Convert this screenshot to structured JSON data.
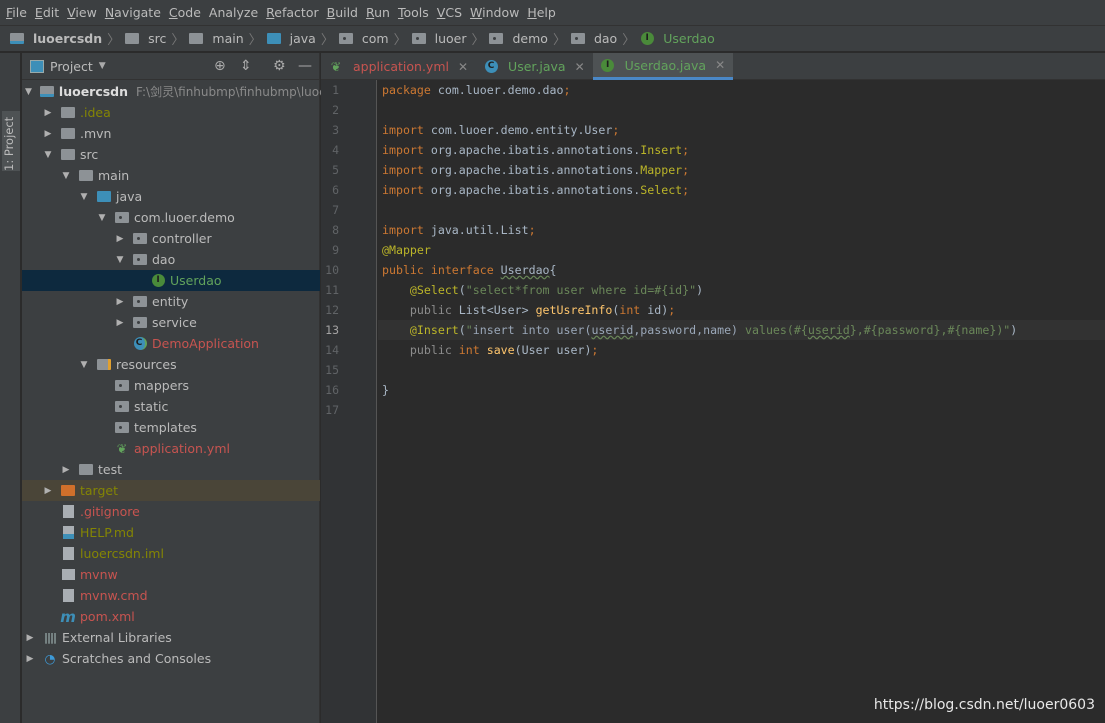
{
  "menu": [
    {
      "u": "F",
      "rest": "ile"
    },
    {
      "u": "E",
      "rest": "dit"
    },
    {
      "u": "V",
      "rest": "iew"
    },
    {
      "u": "N",
      "rest": "avigate"
    },
    {
      "u": "C",
      "rest": "ode"
    },
    {
      "u": "",
      "rest": "Analyze"
    },
    {
      "u": "R",
      "rest": "efactor"
    },
    {
      "u": "B",
      "rest": "uild"
    },
    {
      "u": "R",
      "rest": "un"
    },
    {
      "u": "T",
      "rest": "ools"
    },
    {
      "u": "V",
      "rest": "CS"
    },
    {
      "u": "W",
      "rest": "indow"
    },
    {
      "u": "H",
      "rest": "elp"
    }
  ],
  "breadcrumb": [
    {
      "label": "luoercsdn",
      "icon": "module"
    },
    {
      "label": "src",
      "icon": "folder"
    },
    {
      "label": "main",
      "icon": "folder"
    },
    {
      "label": "java",
      "icon": "source-folder"
    },
    {
      "label": "com",
      "icon": "package"
    },
    {
      "label": "luoer",
      "icon": "package"
    },
    {
      "label": "demo",
      "icon": "package"
    },
    {
      "label": "dao",
      "icon": "package"
    },
    {
      "label": "Userdao",
      "icon": "interface"
    }
  ],
  "stripe": {
    "label": "1: Project"
  },
  "project": {
    "title": "Project",
    "tree": [
      {
        "d": 0,
        "label": "luoercsdn",
        "path": "F:\\剑灵\\finhubmp\\finhubmp\\luoer",
        "icon": "module",
        "arrow": "down",
        "color": "bold"
      },
      {
        "d": 1,
        "label": ".idea",
        "icon": "folder",
        "arrow": "right",
        "color": "olive"
      },
      {
        "d": 1,
        "label": ".mvn",
        "icon": "folder",
        "arrow": "right",
        "color": "default"
      },
      {
        "d": 1,
        "label": "src",
        "icon": "folder",
        "arrow": "down",
        "color": "default"
      },
      {
        "d": 2,
        "label": "main",
        "icon": "folder",
        "arrow": "down",
        "color": "default"
      },
      {
        "d": 3,
        "label": "java",
        "icon": "source-folder",
        "arrow": "down",
        "color": "default"
      },
      {
        "d": 4,
        "label": "com.luoer.demo",
        "icon": "package",
        "arrow": "down",
        "color": "default"
      },
      {
        "d": 5,
        "label": "controller",
        "icon": "package",
        "arrow": "right",
        "color": "default"
      },
      {
        "d": 5,
        "label": "dao",
        "icon": "package",
        "arrow": "down",
        "color": "default"
      },
      {
        "d": 6,
        "label": "Userdao",
        "icon": "interface",
        "arrow": "",
        "color": "green",
        "selected": true
      },
      {
        "d": 5,
        "label": "entity",
        "icon": "package",
        "arrow": "right",
        "color": "default"
      },
      {
        "d": 5,
        "label": "service",
        "icon": "package",
        "arrow": "right",
        "color": "default"
      },
      {
        "d": 5,
        "label": "DemoApplication",
        "icon": "spring-class",
        "arrow": "",
        "color": "red"
      },
      {
        "d": 3,
        "label": "resources",
        "icon": "resources-folder",
        "arrow": "down",
        "color": "default"
      },
      {
        "d": 4,
        "label": "mappers",
        "icon": "package",
        "arrow": "",
        "color": "default"
      },
      {
        "d": 4,
        "label": "static",
        "icon": "package",
        "arrow": "",
        "color": "default"
      },
      {
        "d": 4,
        "label": "templates",
        "icon": "package",
        "arrow": "",
        "color": "default"
      },
      {
        "d": 4,
        "label": "application.yml",
        "icon": "spring-yml",
        "arrow": "",
        "color": "red"
      },
      {
        "d": 2,
        "label": "test",
        "icon": "folder",
        "arrow": "right",
        "color": "default"
      },
      {
        "d": 1,
        "label": "target",
        "icon": "excluded-folder",
        "arrow": "right",
        "color": "olive",
        "excluded": true
      },
      {
        "d": 1,
        "label": ".gitignore",
        "icon": "ignore-file",
        "arrow": "",
        "color": "red"
      },
      {
        "d": 1,
        "label": "HELP.md",
        "icon": "markdown-file",
        "arrow": "",
        "color": "olive"
      },
      {
        "d": 1,
        "label": "luoercsdn.iml",
        "icon": "iml-file",
        "arrow": "",
        "color": "olive"
      },
      {
        "d": 1,
        "label": "mvnw",
        "icon": "shell-file",
        "arrow": "",
        "color": "red"
      },
      {
        "d": 1,
        "label": "mvnw.cmd",
        "icon": "text-file",
        "arrow": "",
        "color": "red"
      },
      {
        "d": 1,
        "label": "pom.xml",
        "icon": "maven-file",
        "arrow": "",
        "color": "red"
      },
      {
        "d": 0,
        "label": "External Libraries",
        "icon": "libraries",
        "arrow": "right",
        "color": "default"
      },
      {
        "d": 0,
        "label": "Scratches and Consoles",
        "icon": "scratches",
        "arrow": "right",
        "color": "default"
      }
    ]
  },
  "tabs": [
    {
      "label": "application.yml",
      "icon": "spring-yml",
      "color": "#c75450"
    },
    {
      "label": "User.java",
      "icon": "class",
      "color": "#62a35c"
    },
    {
      "label": "Userdao.java",
      "icon": "interface",
      "color": "#62a35c",
      "active": true
    }
  ],
  "editor": {
    "current_line": 13,
    "lines": [
      [
        [
          "package",
          "kw"
        ],
        [
          " com.luoer.demo.dao",
          "def"
        ],
        [
          ";",
          "kw"
        ]
      ],
      [],
      [
        [
          "import",
          "kw"
        ],
        [
          " com.luoer.demo.entity.User",
          "def"
        ],
        [
          ";",
          "kw"
        ]
      ],
      [
        [
          "import",
          "kw"
        ],
        [
          " org.apache.ibatis.annotations.",
          "def"
        ],
        [
          "Insert",
          "ann"
        ],
        [
          ";",
          "kw"
        ]
      ],
      [
        [
          "import",
          "kw"
        ],
        [
          " org.apache.ibatis.annotations.",
          "def"
        ],
        [
          "Mapper",
          "ann"
        ],
        [
          ";",
          "kw"
        ]
      ],
      [
        [
          "import",
          "kw"
        ],
        [
          " org.apache.ibatis.annotations.",
          "def"
        ],
        [
          "Select",
          "ann"
        ],
        [
          ";",
          "kw"
        ]
      ],
      [],
      [
        [
          "import",
          "kw"
        ],
        [
          " java.util.List",
          "def"
        ],
        [
          ";",
          "kw"
        ]
      ],
      [
        [
          "@Mapper",
          "ann"
        ]
      ],
      [
        [
          "public interface ",
          "kw"
        ],
        [
          "Userdao",
          "def wavy"
        ],
        [
          "{",
          "def"
        ]
      ],
      [
        [
          "    ",
          "def"
        ],
        [
          "@Select",
          "ann"
        ],
        [
          "(",
          "def"
        ],
        [
          "\"select*from user where id=#{id}\"",
          "str"
        ],
        [
          ")",
          "def"
        ]
      ],
      [
        [
          "    ",
          "def"
        ],
        [
          "public ",
          "mod"
        ],
        [
          "List<User> ",
          "def"
        ],
        [
          "getUsreInfo",
          "fn"
        ],
        [
          "(",
          "def"
        ],
        [
          "int ",
          "kw"
        ],
        [
          "id)",
          "def"
        ],
        [
          ";",
          "kw"
        ]
      ],
      [
        [
          "    ",
          "def"
        ],
        [
          "@Insert",
          "ann"
        ],
        [
          "(",
          "def"
        ],
        [
          "\"",
          "str"
        ],
        [
          "insert into user(",
          "sql"
        ],
        [
          "userid",
          "sql wavy"
        ],
        [
          ",password,name) ",
          "sql"
        ],
        [
          "values(#{",
          "str"
        ],
        [
          "userid",
          "str wavy"
        ],
        [
          "},#{password},#{name})\"",
          "str"
        ],
        [
          ")",
          "def"
        ]
      ],
      [
        [
          "    ",
          "def"
        ],
        [
          "public ",
          "mod"
        ],
        [
          "int ",
          "kw"
        ],
        [
          "save",
          "fn"
        ],
        [
          "(User user)",
          "def"
        ],
        [
          ";",
          "kw"
        ]
      ],
      [],
      [
        [
          "}",
          "def"
        ]
      ],
      []
    ]
  },
  "watermark": "https://blog.csdn.net/luoer0603"
}
